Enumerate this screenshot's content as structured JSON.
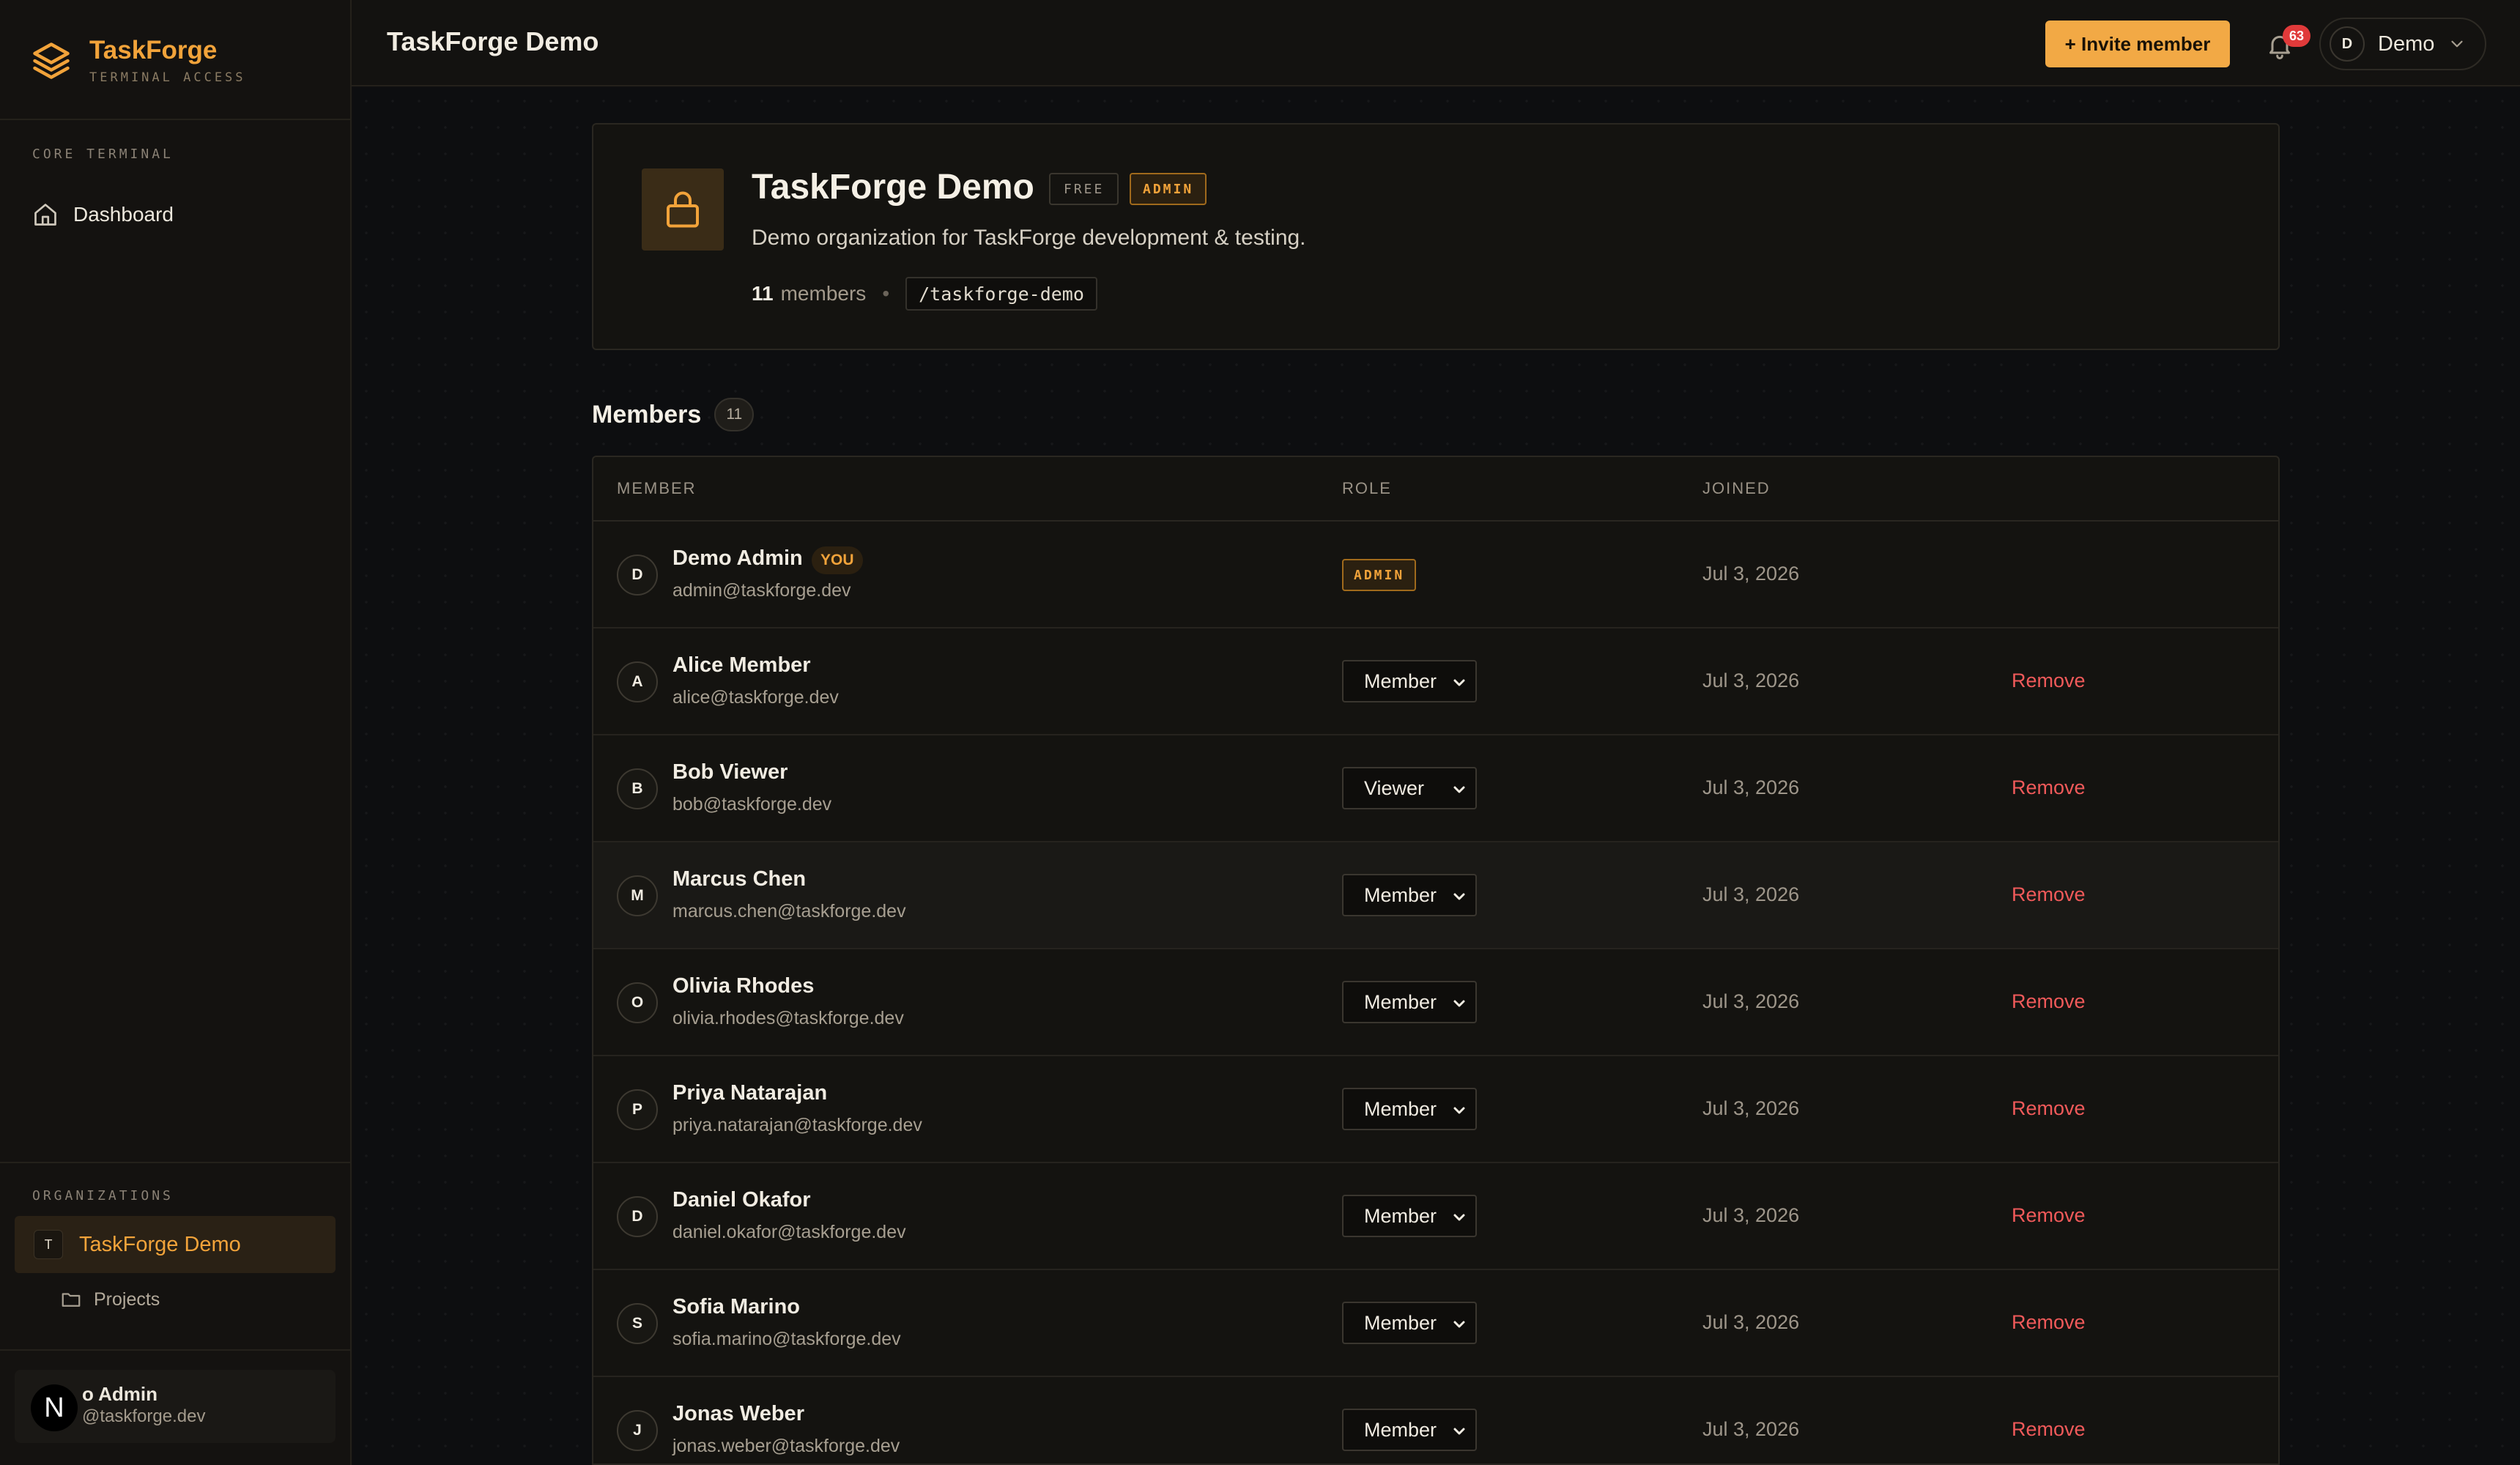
{
  "brand": {
    "name": "TaskForge",
    "subtitle": "TERMINAL ACCESS"
  },
  "sidebar": {
    "core_section": "CORE TERMINAL",
    "nav": [
      {
        "label": "Dashboard",
        "icon": "home-icon"
      }
    ],
    "org_section": "ORGANIZATIONS",
    "org": {
      "badge": "T",
      "name": "TaskForge Demo"
    },
    "sub_items": [
      {
        "label": "Projects",
        "icon": "folder-icon"
      }
    ],
    "user": {
      "avatar": "N",
      "name_visible": "o Admin",
      "email_visible": "@taskforge.dev"
    }
  },
  "topbar": {
    "title": "TaskForge Demo",
    "invite_label": "+ Invite member",
    "notifications": "63",
    "account": {
      "avatar": "D",
      "name": "Demo"
    }
  },
  "org": {
    "name": "TaskForge Demo",
    "plan_tag": "FREE",
    "role_tag": "ADMIN",
    "description": "Demo organization for TaskForge development & testing.",
    "member_count": "11",
    "members_word": "members",
    "separator": "•",
    "slug": "/taskforge-demo"
  },
  "members_section": {
    "title": "Members",
    "count": "11"
  },
  "table": {
    "headers": {
      "member": "MEMBER",
      "role": "ROLE",
      "joined": "JOINED"
    },
    "rows": [
      {
        "initial": "D",
        "name": "Demo Admin",
        "you": "YOU",
        "email": "admin@taskforge.dev",
        "role": "ADMIN",
        "joined": "Jul 3, 2026",
        "action": ""
      },
      {
        "initial": "A",
        "name": "Alice Member",
        "email": "alice@taskforge.dev",
        "role": "Member",
        "joined": "Jul 3, 2026",
        "action": "Remove"
      },
      {
        "initial": "B",
        "name": "Bob Viewer",
        "email": "bob@taskforge.dev",
        "role": "Viewer",
        "joined": "Jul 3, 2026",
        "action": "Remove"
      },
      {
        "initial": "M",
        "name": "Marcus Chen",
        "email": "marcus.chen@taskforge.dev",
        "role": "Member",
        "joined": "Jul 3, 2026",
        "action": "Remove"
      },
      {
        "initial": "O",
        "name": "Olivia Rhodes",
        "email": "olivia.rhodes@taskforge.dev",
        "role": "Member",
        "joined": "Jul 3, 2026",
        "action": "Remove"
      },
      {
        "initial": "P",
        "name": "Priya Natarajan",
        "email": "priya.natarajan@taskforge.dev",
        "role": "Member",
        "joined": "Jul 3, 2026",
        "action": "Remove"
      },
      {
        "initial": "D",
        "name": "Daniel Okafor",
        "email": "daniel.okafor@taskforge.dev",
        "role": "Member",
        "joined": "Jul 3, 2026",
        "action": "Remove"
      },
      {
        "initial": "S",
        "name": "Sofia Marino",
        "email": "sofia.marino@taskforge.dev",
        "role": "Member",
        "joined": "Jul 3, 2026",
        "action": "Remove"
      },
      {
        "initial": "J",
        "name": "Jonas Weber",
        "email": "jonas.weber@taskforge.dev",
        "role": "Member",
        "joined": "Jul 3, 2026",
        "action": "Remove"
      }
    ]
  },
  "colors": {
    "accent": "#f2a33a",
    "danger": "#f05a5a",
    "background": "#0d0e10",
    "panel": "#141310"
  }
}
